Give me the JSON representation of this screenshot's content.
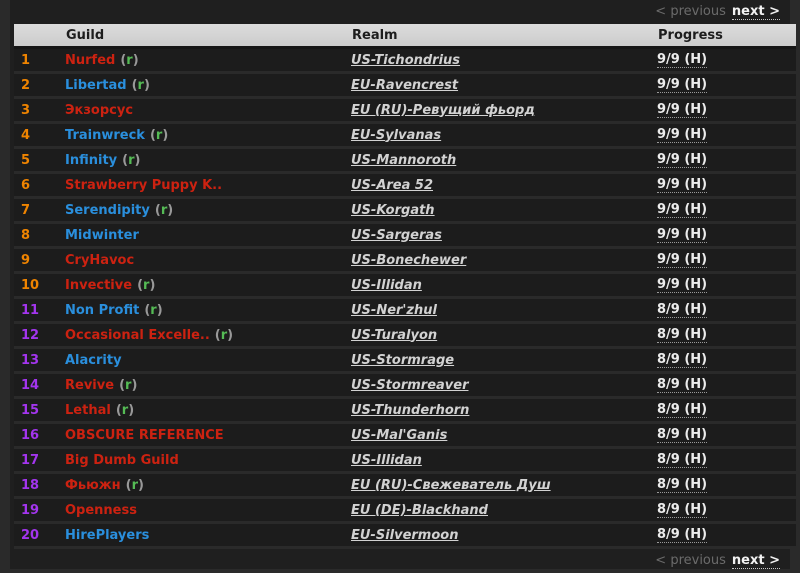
{
  "nav": {
    "previous_label": "< previous",
    "next_label": "next >"
  },
  "table": {
    "headers": {
      "rank": "",
      "guild": "Guild",
      "realm": "Realm",
      "progress": "Progress"
    },
    "recruit_mark": {
      "open": "(",
      "letter": "r",
      "close": ")"
    },
    "rows": [
      {
        "rank": "1",
        "tier": "top10",
        "guild": "Nurfed",
        "faction": "red",
        "recruiting": true,
        "realm": "US-Tichondrius",
        "progress": "9/9 (H)"
      },
      {
        "rank": "2",
        "tier": "top10",
        "guild": "Libertad",
        "faction": "blue",
        "recruiting": true,
        "realm": "EU-Ravencrest",
        "progress": "9/9 (H)"
      },
      {
        "rank": "3",
        "tier": "top10",
        "guild": "Экзорсус",
        "faction": "red",
        "recruiting": false,
        "realm": "EU (RU)-Ревущий фьорд",
        "progress": "9/9 (H)"
      },
      {
        "rank": "4",
        "tier": "top10",
        "guild": "Trainwreck",
        "faction": "blue",
        "recruiting": true,
        "realm": "EU-Sylvanas",
        "progress": "9/9 (H)"
      },
      {
        "rank": "5",
        "tier": "top10",
        "guild": "Infinity",
        "faction": "blue",
        "recruiting": true,
        "realm": "US-Mannoroth",
        "progress": "9/9 (H)"
      },
      {
        "rank": "6",
        "tier": "top10",
        "guild": "Strawberry Puppy K..",
        "faction": "red",
        "recruiting": false,
        "realm": "US-Area 52",
        "progress": "9/9 (H)"
      },
      {
        "rank": "7",
        "tier": "top10",
        "guild": "Serendipity",
        "faction": "blue",
        "recruiting": true,
        "realm": "US-Korgath",
        "progress": "9/9 (H)"
      },
      {
        "rank": "8",
        "tier": "top10",
        "guild": "Midwinter",
        "faction": "blue",
        "recruiting": false,
        "realm": "US-Sargeras",
        "progress": "9/9 (H)"
      },
      {
        "rank": "9",
        "tier": "top10",
        "guild": "CryHavoc",
        "faction": "red",
        "recruiting": false,
        "realm": "US-Bonechewer",
        "progress": "9/9 (H)"
      },
      {
        "rank": "10",
        "tier": "top10",
        "guild": "Invective",
        "faction": "red",
        "recruiting": true,
        "realm": "US-Illidan",
        "progress": "9/9 (H)"
      },
      {
        "rank": "11",
        "tier": "sub10",
        "guild": "Non Profit",
        "faction": "blue",
        "recruiting": true,
        "realm": "US-Ner'zhul",
        "progress": "8/9 (H)"
      },
      {
        "rank": "12",
        "tier": "sub10",
        "guild": "Occasional Excelle..",
        "faction": "red",
        "recruiting": true,
        "realm": "US-Turalyon",
        "progress": "8/9 (H)"
      },
      {
        "rank": "13",
        "tier": "sub10",
        "guild": "Alacrity",
        "faction": "blue",
        "recruiting": false,
        "realm": "US-Stormrage",
        "progress": "8/9 (H)"
      },
      {
        "rank": "14",
        "tier": "sub10",
        "guild": "Revive",
        "faction": "red",
        "recruiting": true,
        "realm": "US-Stormreaver",
        "progress": "8/9 (H)"
      },
      {
        "rank": "15",
        "tier": "sub10",
        "guild": "Lethal",
        "faction": "red",
        "recruiting": true,
        "realm": "US-Thunderhorn",
        "progress": "8/9 (H)"
      },
      {
        "rank": "16",
        "tier": "sub10",
        "guild": "OBSCURE REFERENCE",
        "faction": "red",
        "recruiting": false,
        "realm": "US-Mal'Ganis",
        "progress": "8/9 (H)"
      },
      {
        "rank": "17",
        "tier": "sub10",
        "guild": "Big Dumb Guild",
        "faction": "red",
        "recruiting": false,
        "realm": "US-Illidan",
        "progress": "8/9 (H)"
      },
      {
        "rank": "18",
        "tier": "sub10",
        "guild": "Фьюжн",
        "faction": "red",
        "recruiting": true,
        "realm": "EU (RU)-Свежеватель Душ",
        "progress": "8/9 (H)"
      },
      {
        "rank": "19",
        "tier": "sub10",
        "guild": "Openness",
        "faction": "red",
        "recruiting": false,
        "realm": "EU (DE)-Blackhand",
        "progress": "8/9 (H)"
      },
      {
        "rank": "20",
        "tier": "sub10",
        "guild": "HirePlayers",
        "faction": "blue",
        "recruiting": false,
        "realm": "EU-Silvermoon",
        "progress": "8/9 (H)"
      }
    ]
  },
  "colors": {
    "page_bg": "#2a2a2a",
    "panel_bg": "#1f1f1f",
    "row_bg": "#1c1c1c",
    "header_bg": "#d6d6d6",
    "rank_orange": "#ef8400",
    "rank_purple": "#a335ee",
    "guild_red": "#cc2211",
    "guild_blue": "#2a8fdd",
    "recruit_green": "#55bb55",
    "paren_gray": "#999999",
    "link_gray": "#d2d2d2"
  }
}
